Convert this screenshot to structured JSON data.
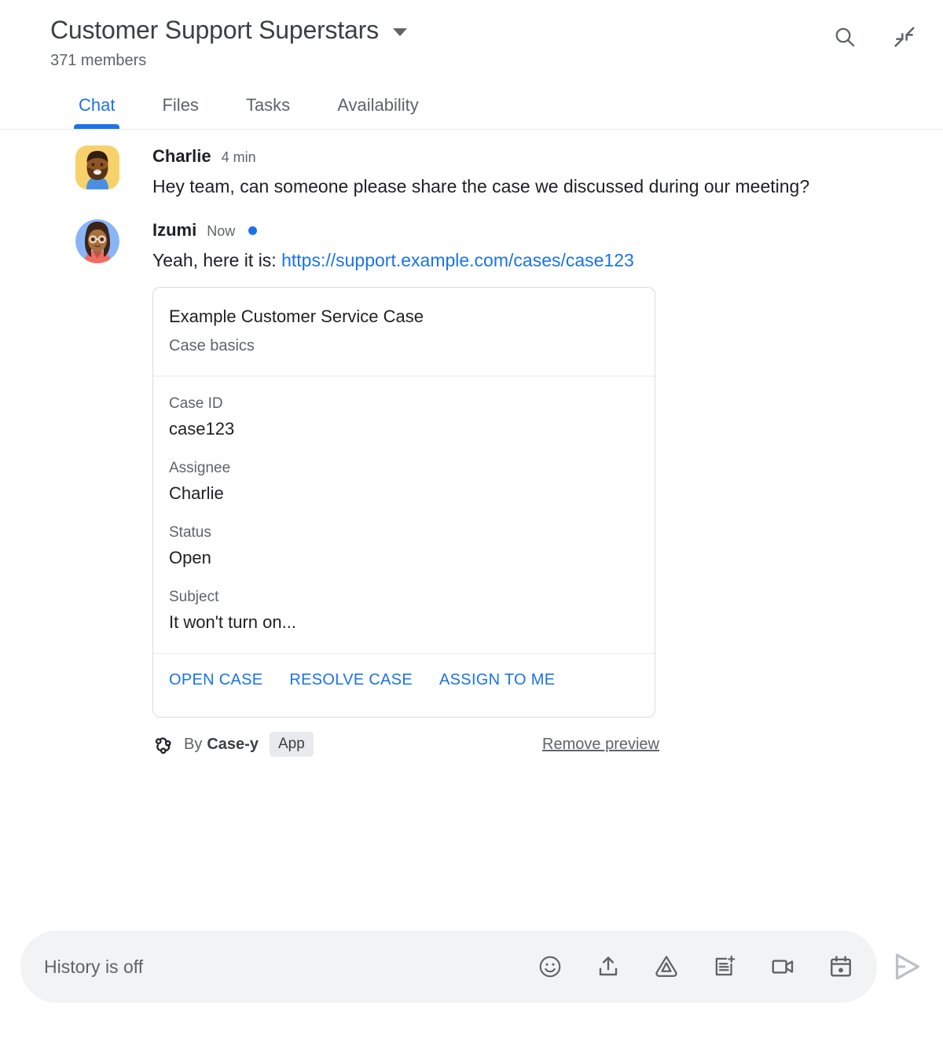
{
  "header": {
    "room_title": "Customer Support Superstars",
    "member_count": "371 members",
    "dropdown_icon": "chevron-down-icon",
    "search_icon": "search-icon",
    "collapse_icon": "collapse-arrows-icon"
  },
  "tabs": [
    {
      "label": "Chat",
      "active": true
    },
    {
      "label": "Files",
      "active": false
    },
    {
      "label": "Tasks",
      "active": false
    },
    {
      "label": "Availability",
      "active": false
    }
  ],
  "messages": [
    {
      "sender": "Charlie",
      "timestamp": "4 min",
      "unread": false,
      "text": "Hey team, can someone please share the case we discussed during our meeting?"
    },
    {
      "sender": "Izumi",
      "timestamp": "Now",
      "unread": true,
      "text_prefix": "Yeah, here it is: ",
      "link_text": "https://support.example.com/cases/case123"
    }
  ],
  "card": {
    "title": "Example Customer Service Case",
    "subtitle": "Case basics",
    "fields": [
      {
        "label": "Case ID",
        "value": "case123"
      },
      {
        "label": "Assignee",
        "value": "Charlie"
      },
      {
        "label": "Status",
        "value": "Open"
      },
      {
        "label": "Subject",
        "value": "It won't turn on..."
      }
    ],
    "actions": [
      {
        "label": "OPEN CASE"
      },
      {
        "label": "RESOLVE CASE"
      },
      {
        "label": "ASSIGN TO ME"
      }
    ],
    "footer": {
      "by_label": "By",
      "app_name": "Case-y",
      "app_badge": "App",
      "remove_preview": "Remove preview",
      "app_icon": "webhook-icon"
    }
  },
  "composer": {
    "placeholder": "History is off",
    "icons": [
      "emoji-icon",
      "upload-icon",
      "google-drive-icon",
      "add-document-icon",
      "video-camera-icon",
      "calendar-icon"
    ],
    "send_icon": "send-icon"
  },
  "colors": {
    "accent": "#1a73e8",
    "text_primary": "#202124",
    "text_secondary": "#5f6368",
    "border": "#dadce0",
    "composer_bg": "#f1f3f4",
    "badge_bg": "#e8eaed",
    "send_disabled": "#bdc1c6"
  }
}
